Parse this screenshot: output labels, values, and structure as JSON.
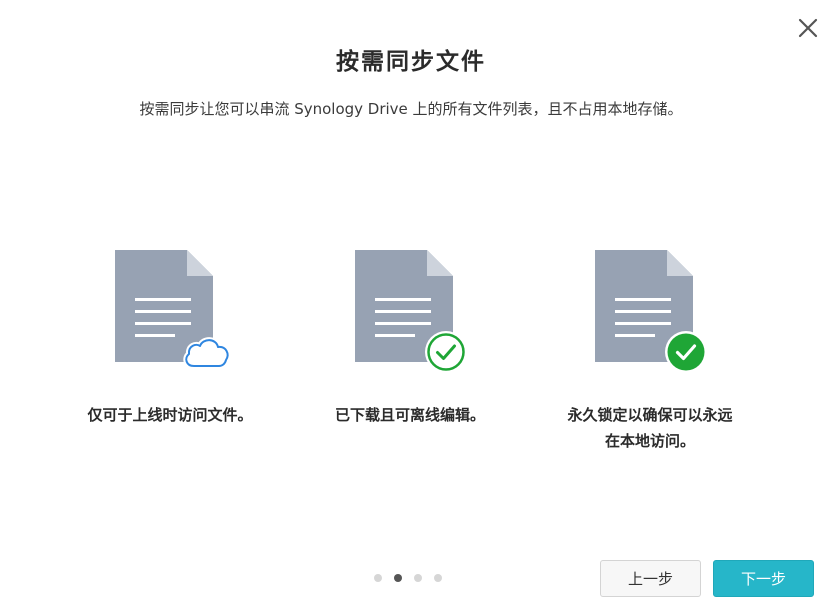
{
  "dialog": {
    "title": "按需同步文件",
    "subtitle": "按需同步让您可以串流 Synology Drive 上的所有文件列表，且不占用本地存储。",
    "close_icon": "close-icon"
  },
  "features": [
    {
      "icon": "document-cloud-icon",
      "label_lines": [
        "仅可于上线时访问文件。"
      ]
    },
    {
      "icon": "document-check-outline-icon",
      "label_lines": [
        "已下载且可离线编辑。"
      ]
    },
    {
      "icon": "document-check-filled-icon",
      "label_lines": [
        "永久锁定以确保可以永远",
        "在本地访问。"
      ]
    }
  ],
  "pagination": {
    "total": 4,
    "current": 2
  },
  "buttons": {
    "prev_label": "上一步",
    "next_label": "下一步"
  },
  "colors": {
    "document": "#97a2b3",
    "cloud_blue": "#2f86e0",
    "check_green": "#1fa636",
    "accent_teal": "#26b6c9"
  }
}
